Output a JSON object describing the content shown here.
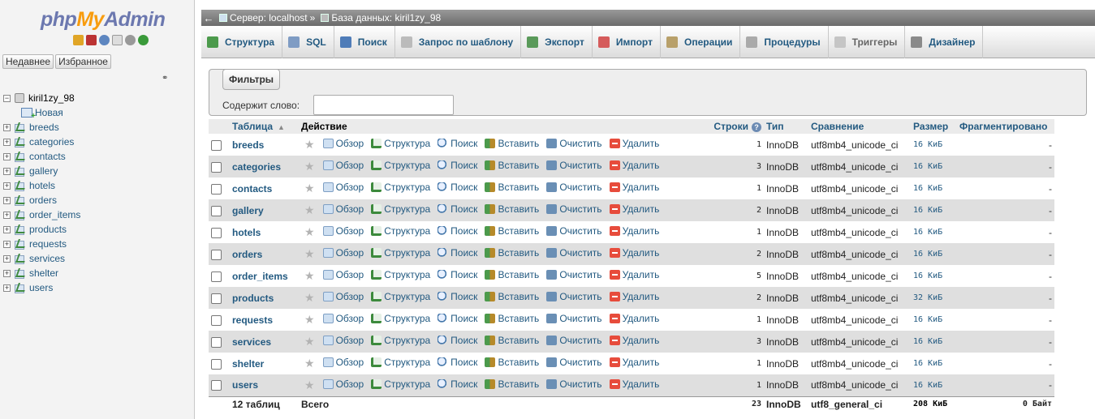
{
  "nav": {
    "logo": {
      "php": "php",
      "my": "My",
      "admin": "Admin"
    },
    "tabs": [
      "Недавнее",
      "Избранное"
    ],
    "database": "kiril1zy_98",
    "new_label": "Новая",
    "tables": [
      "breeds",
      "categories",
      "contacts",
      "gallery",
      "hotels",
      "orders",
      "order_items",
      "products",
      "requests",
      "services",
      "shelter",
      "users"
    ],
    "icons": [
      "home-icon",
      "database-icon",
      "help-icon",
      "docs-icon",
      "settings-icon",
      "reload-icon"
    ]
  },
  "breadcrumb": {
    "server": "Сервер: localhost",
    "separator": "»",
    "database": "База данных: kiril1zy_98"
  },
  "menu": [
    {
      "label": "Структура",
      "icon": "structure-icon",
      "color": "#4c9a4c"
    },
    {
      "label": "SQL",
      "icon": "sql-icon",
      "color": "#7f9cc4"
    },
    {
      "label": "Поиск",
      "icon": "search-icon",
      "color": "#4f7cb8"
    },
    {
      "label": "Запрос по шаблону",
      "icon": "query-icon",
      "color": "#bbbbbb"
    },
    {
      "label": "Экспорт",
      "icon": "export-icon",
      "color": "#5a9a5a"
    },
    {
      "label": "Импорт",
      "icon": "import-icon",
      "color": "#d55b5b"
    },
    {
      "label": "Операции",
      "icon": "wrench-icon",
      "color": "#b8a06a"
    },
    {
      "label": "Процедуры",
      "icon": "routines-icon",
      "color": "#aaaaaa"
    },
    {
      "label": "Триггеры",
      "icon": "triggers-icon",
      "color": "#c5c5c5",
      "disabled": true
    },
    {
      "label": "Дизайнер",
      "icon": "designer-icon",
      "color": "#8a8a8a"
    }
  ],
  "filters": {
    "legend": "Фильтры",
    "label": "Содержит слово:",
    "value": ""
  },
  "table": {
    "headers": {
      "name": "Таблица",
      "action": "Действие",
      "rows": "Строки",
      "type": "Тип",
      "collation": "Сравнение",
      "size": "Размер",
      "overhead": "Фрагментировано"
    },
    "actions": [
      "Обзор",
      "Структура",
      "Поиск",
      "Вставить",
      "Очистить",
      "Удалить"
    ],
    "rows": [
      {
        "name": "breeds",
        "rows": "1",
        "type": "InnoDB",
        "collation": "utf8mb4_unicode_ci",
        "size": "16 КиБ",
        "overhead": "-"
      },
      {
        "name": "categories",
        "rows": "3",
        "type": "InnoDB",
        "collation": "utf8mb4_unicode_ci",
        "size": "16 КиБ",
        "overhead": "-"
      },
      {
        "name": "contacts",
        "rows": "1",
        "type": "InnoDB",
        "collation": "utf8mb4_unicode_ci",
        "size": "16 КиБ",
        "overhead": "-"
      },
      {
        "name": "gallery",
        "rows": "2",
        "type": "InnoDB",
        "collation": "utf8mb4_unicode_ci",
        "size": "16 КиБ",
        "overhead": "-"
      },
      {
        "name": "hotels",
        "rows": "1",
        "type": "InnoDB",
        "collation": "utf8mb4_unicode_ci",
        "size": "16 КиБ",
        "overhead": "-"
      },
      {
        "name": "orders",
        "rows": "2",
        "type": "InnoDB",
        "collation": "utf8mb4_unicode_ci",
        "size": "16 КиБ",
        "overhead": "-"
      },
      {
        "name": "order_items",
        "rows": "5",
        "type": "InnoDB",
        "collation": "utf8mb4_unicode_ci",
        "size": "16 КиБ",
        "overhead": "-"
      },
      {
        "name": "products",
        "rows": "2",
        "type": "InnoDB",
        "collation": "utf8mb4_unicode_ci",
        "size": "32 КиБ",
        "overhead": "-"
      },
      {
        "name": "requests",
        "rows": "1",
        "type": "InnoDB",
        "collation": "utf8mb4_unicode_ci",
        "size": "16 КиБ",
        "overhead": "-"
      },
      {
        "name": "services",
        "rows": "3",
        "type": "InnoDB",
        "collation": "utf8mb4_unicode_ci",
        "size": "16 КиБ",
        "overhead": "-"
      },
      {
        "name": "shelter",
        "rows": "1",
        "type": "InnoDB",
        "collation": "utf8mb4_unicode_ci",
        "size": "16 КиБ",
        "overhead": "-"
      },
      {
        "name": "users",
        "rows": "1",
        "type": "InnoDB",
        "collation": "utf8mb4_unicode_ci",
        "size": "16 КиБ",
        "overhead": "-"
      }
    ],
    "footer": {
      "count": "12 таблиц",
      "total_label": "Всего",
      "rows": "23",
      "type": "InnoDB",
      "collation": "utf8_general_ci",
      "size": "208 КиБ",
      "overhead": "0 Байт"
    }
  }
}
